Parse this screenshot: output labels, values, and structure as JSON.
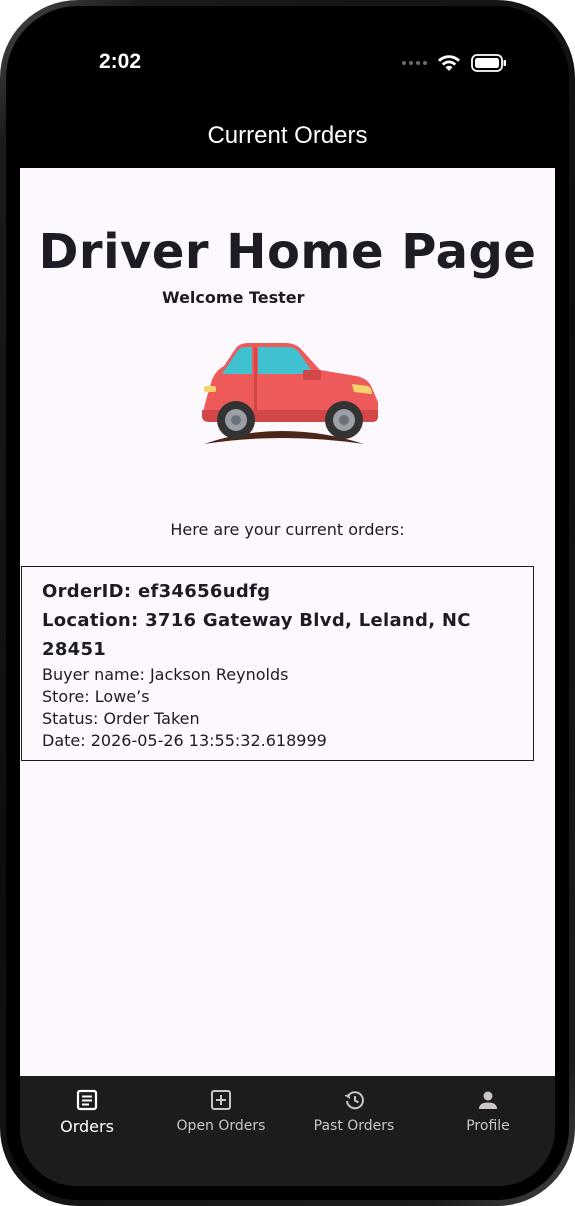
{
  "status_bar": {
    "time": "2:02",
    "icons": [
      "cellular-icon",
      "wifi-icon",
      "battery-icon"
    ]
  },
  "app_bar": {
    "title": "Current Orders"
  },
  "main": {
    "heading": "Driver Home Page",
    "welcome": "Welcome Tester",
    "illustration": "red-car-icon",
    "orders_intro": "Here are your current orders:"
  },
  "order": {
    "order_id": "OrderID: ef34656udfg",
    "location": "Location: 3716 Gateway Blvd, Leland, NC 28451",
    "buyer": "Buyer name: Jackson Reynolds",
    "store": "Store: Lowe’s",
    "status": "Status: Order Taken",
    "date": "Date: 2026-05-26 13:55:32.618999"
  },
  "nav": {
    "items": [
      {
        "label": "Orders",
        "icon": "orders-icon",
        "active": true
      },
      {
        "label": "Open Orders",
        "icon": "add-box-icon",
        "active": false
      },
      {
        "label": "Past Orders",
        "icon": "history-icon",
        "active": false
      },
      {
        "label": "Profile",
        "icon": "person-icon",
        "active": false
      }
    ]
  },
  "colors": {
    "background": "#fdf7fe",
    "app_bar": "#000000",
    "nav_bar": "#1c1b1e",
    "car_body": "#ee5a5a",
    "car_window": "#3fc1cf"
  }
}
